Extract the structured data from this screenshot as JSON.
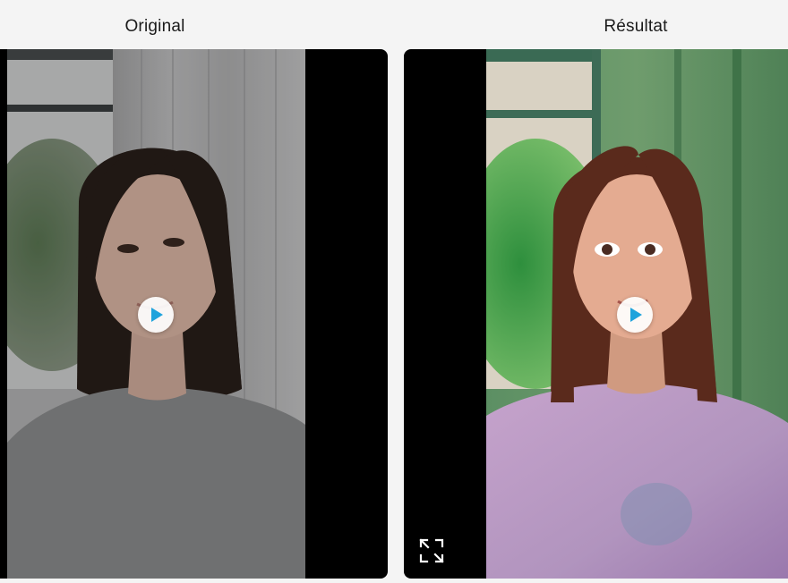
{
  "labels": {
    "original": "Original",
    "result": "Résultat"
  },
  "original_video": {
    "play_icon": "play-icon",
    "accent": "#1fa3dc"
  },
  "result_video": {
    "play_icon": "play-icon",
    "expand_icon": "expand-icon",
    "accent": "#1fa3dc"
  }
}
